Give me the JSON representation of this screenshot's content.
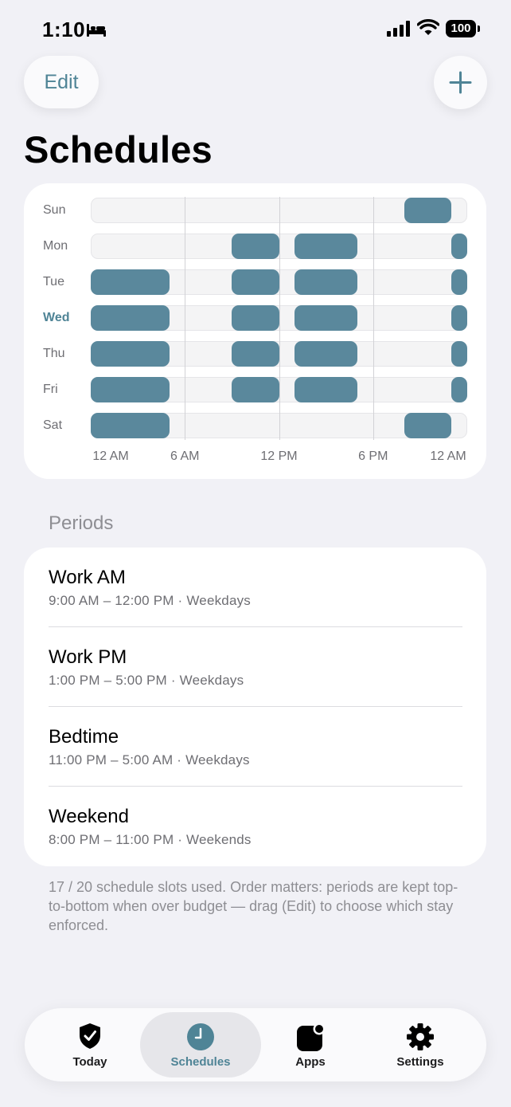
{
  "status": {
    "time": "1:10",
    "battery": "100"
  },
  "header": {
    "edit_label": "Edit",
    "title": "Schedules"
  },
  "calendar": {
    "days": [
      "Sun",
      "Mon",
      "Tue",
      "Wed",
      "Thu",
      "Fri",
      "Sat"
    ],
    "today": "Wed",
    "axis": [
      "12 AM",
      "6 AM",
      "12 PM",
      "6 PM",
      "12 AM"
    ],
    "accent": "#5a889c"
  },
  "periods_title": "Periods",
  "periods": [
    {
      "name": "Work AM",
      "detail": "9:00 AM – 12:00 PM · Weekdays",
      "start": 9,
      "end": 12
    },
    {
      "name": "Work PM",
      "detail": "1:00 PM – 5:00 PM · Weekdays",
      "start": 13,
      "end": 17
    },
    {
      "name": "Bedtime",
      "detail": "11:00 PM – 5:00 AM · Weekdays",
      "start": 23,
      "end": 5
    },
    {
      "name": "Weekend",
      "detail": "8:00 PM – 11:00 PM · Weekends",
      "start": 20,
      "end": 23
    }
  ],
  "footnote": "17 / 20 schedule slots used. Order matters: periods are kept top-to-bottom when over budget — drag (Edit) to choose which stay enforced.",
  "tabs": [
    {
      "label": "Today",
      "icon": "shield-check-icon"
    },
    {
      "label": "Schedules",
      "icon": "clock-icon"
    },
    {
      "label": "Apps",
      "icon": "app-badge-icon"
    },
    {
      "label": "Settings",
      "icon": "gear-icon"
    }
  ]
}
